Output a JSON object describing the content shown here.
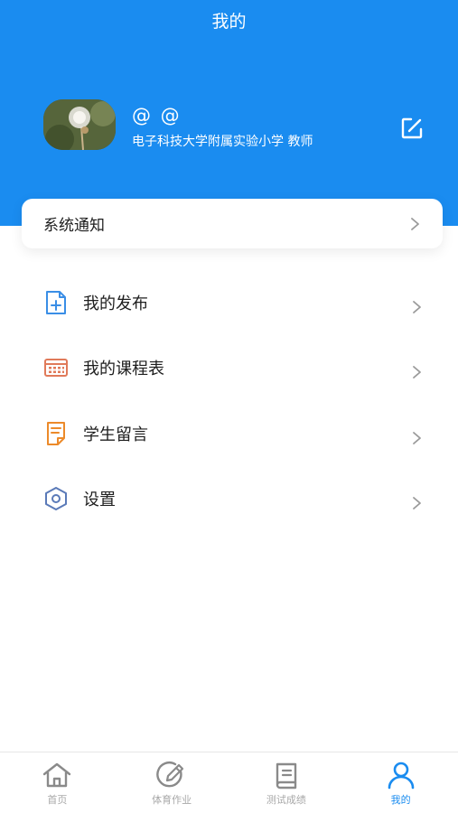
{
  "header": {
    "title": "我的",
    "background": "#1a8cf0"
  },
  "profile": {
    "nickname": "@ @",
    "description": "电子科技大学附属实验小学 教师",
    "avatar_icon": "dandelion-photo",
    "edit_icon": "edit-icon"
  },
  "notice": {
    "label": "系统通知"
  },
  "menu": [
    {
      "label": "我的发布",
      "icon": "document-add-icon",
      "color": "#3a8ee6"
    },
    {
      "label": "我的课程表",
      "icon": "calendar-icon",
      "color": "#e07a5a"
    },
    {
      "label": "学生留言",
      "icon": "note-icon",
      "color": "#ec8a2a"
    },
    {
      "label": "设置",
      "icon": "hexagon-settings-icon",
      "color": "#5a7ab8"
    }
  ],
  "tabbar": {
    "items": [
      {
        "label": "首页",
        "icon": "home-icon",
        "active": false
      },
      {
        "label": "体育作业",
        "icon": "pencil-circle-icon",
        "active": false
      },
      {
        "label": "测试成绩",
        "icon": "book-icon",
        "active": false
      },
      {
        "label": "我的",
        "icon": "person-icon",
        "active": true
      }
    ],
    "active_color": "#1a8cf0",
    "inactive_color": "#8a8a8a"
  }
}
